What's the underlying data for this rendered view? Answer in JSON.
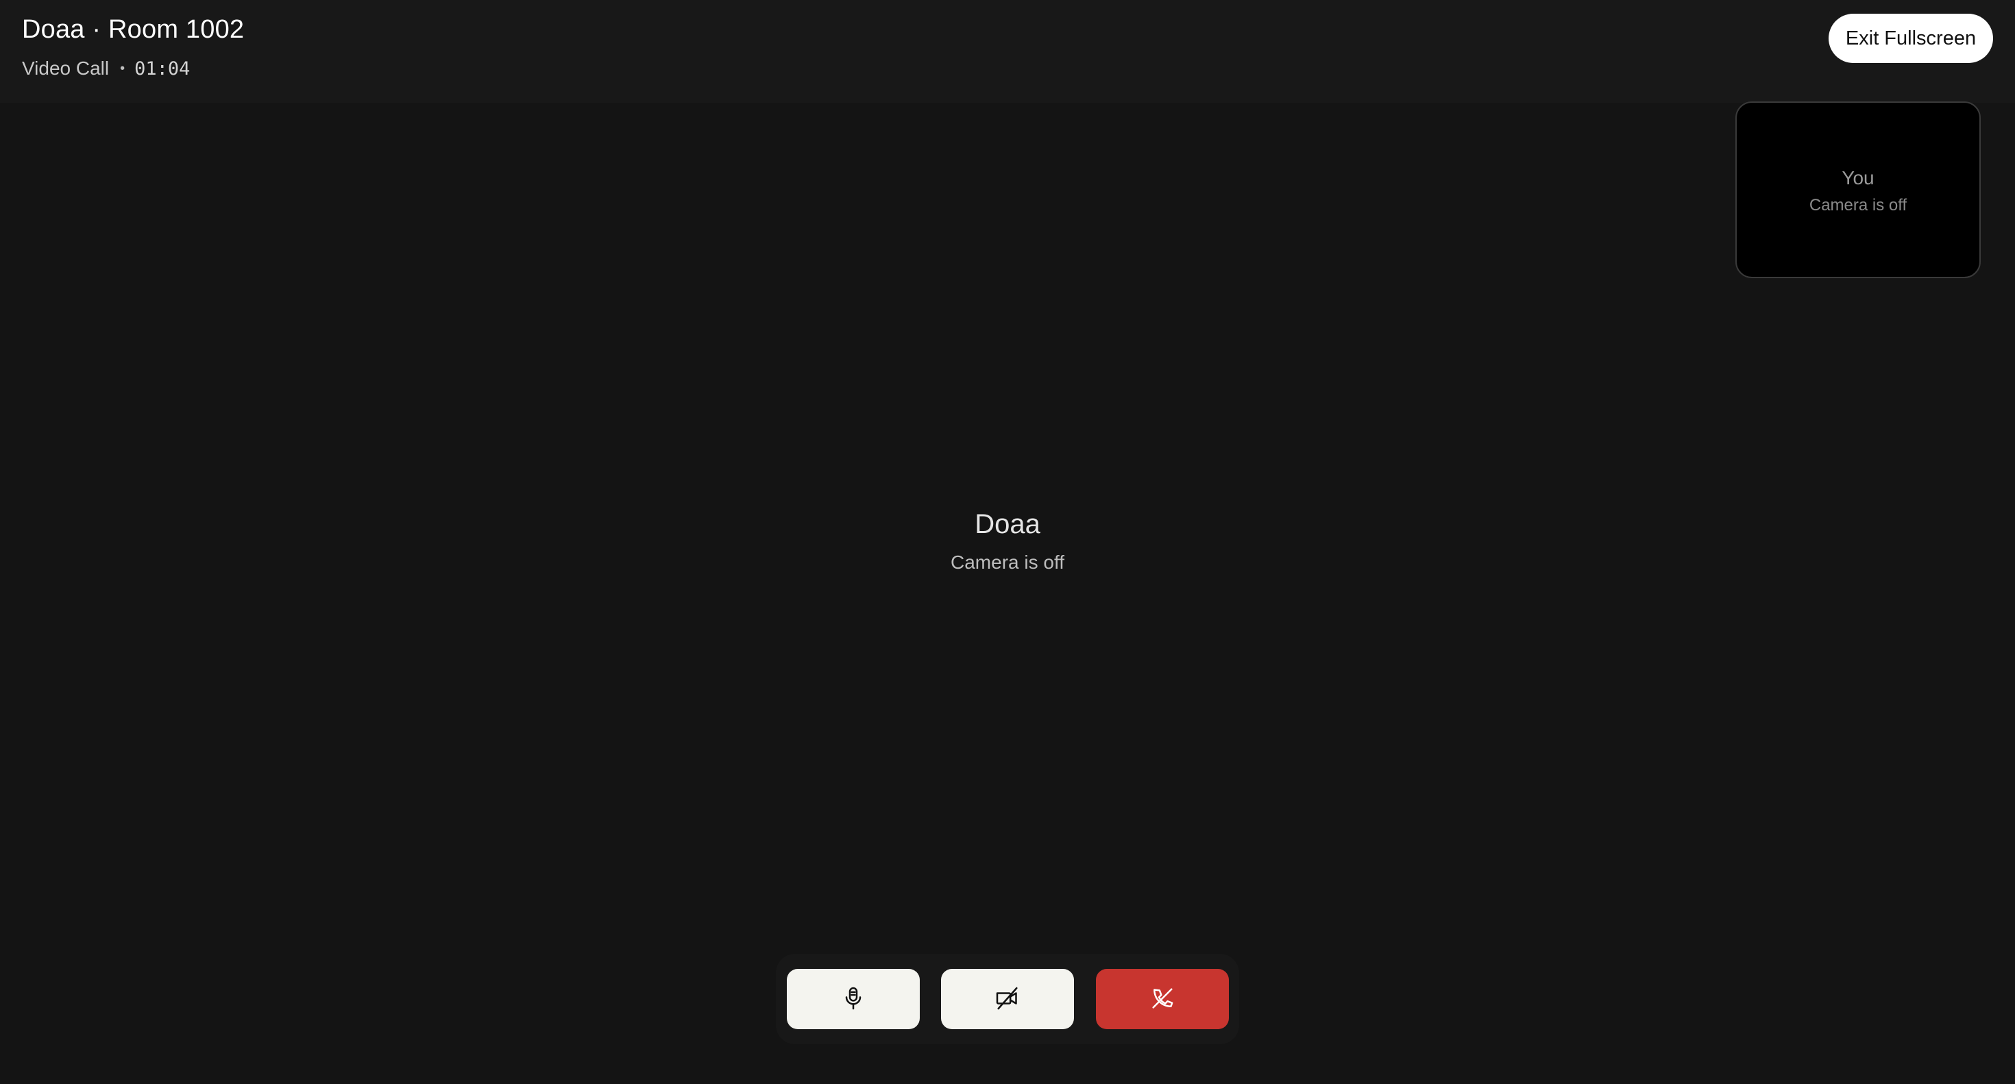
{
  "header": {
    "title": "Doaa · Room 1002",
    "call_type": "Video Call",
    "separator": "•",
    "timer": "01:04",
    "exit_fullscreen_label": "Exit Fullscreen"
  },
  "self_view": {
    "name": "You",
    "status": "Camera is off"
  },
  "remote": {
    "name": "Doaa",
    "status": "Camera is off"
  },
  "controls": {
    "mic_icon": "microphone-icon",
    "camera_icon": "camera-off-icon",
    "end_call_icon": "phone-hangup-icon"
  },
  "colors": {
    "background": "#141414",
    "header_background": "#181818",
    "control_button": "#f4f4ef",
    "end_call": "#c8352f",
    "self_tile": "#000000"
  }
}
